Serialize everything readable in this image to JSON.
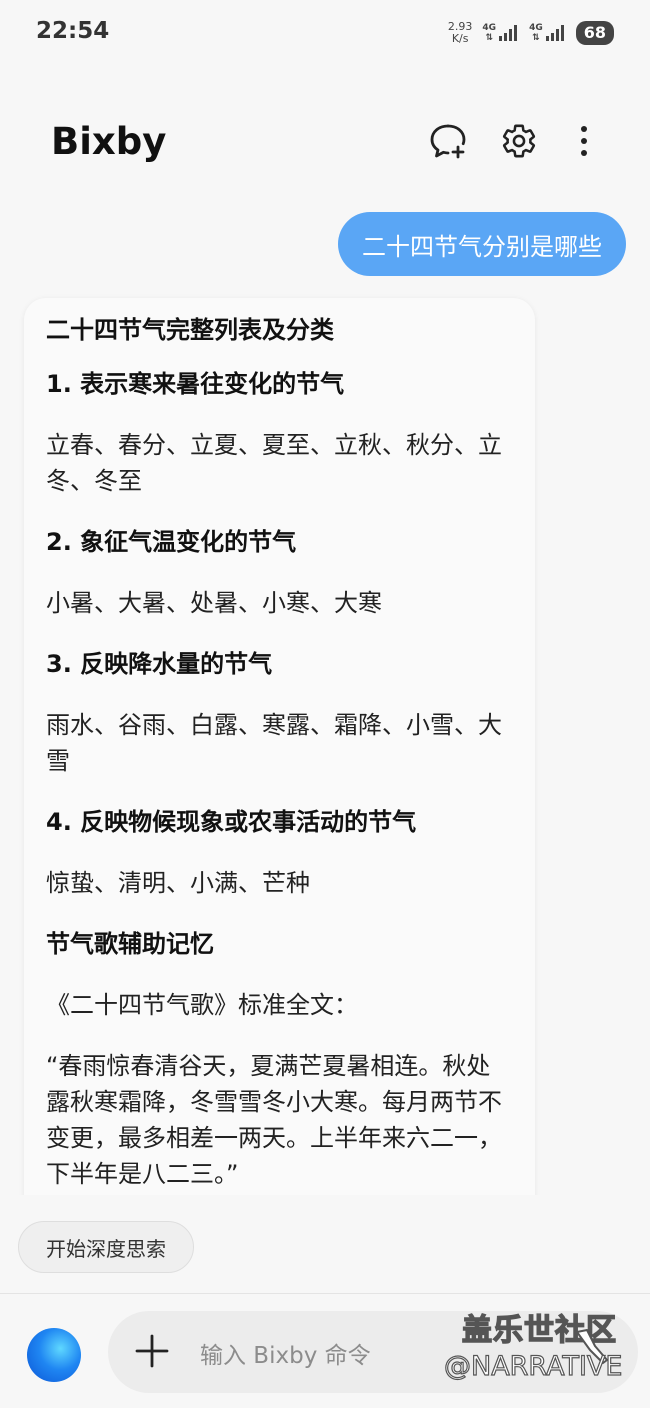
{
  "status_bar": {
    "time": "22:54",
    "net_speed_value": "2.93",
    "net_speed_unit": "K/s",
    "sim1_type": "4G",
    "sim2_type": "4G",
    "battery": "68"
  },
  "header": {
    "title": "Bixby"
  },
  "chat": {
    "user_message": "二十四节气分别是哪些",
    "reply": {
      "title": "二十四节气完整列表及分类",
      "s1_heading": "1. 表示寒来暑往变化的节气",
      "s1_body": "立春、春分、立夏、夏至、立秋、秋分、立冬、冬至",
      "s2_heading": "2. 象征气温变化的节气",
      "s2_body": "小暑、大暑、处暑、小寒、大寒",
      "s3_heading": "3. 反映降水量的节气",
      "s3_body": "雨水、谷雨、白露、寒露、霜降、小雪、大雪",
      "s4_heading": "4. 反映物候现象或农事活动的节气",
      "s4_body": "惊蛰、清明、小满、芒种",
      "song_heading": "节气歌辅助记忆",
      "song_intro": "《二十四节气歌》标准全文：",
      "song_text": "“春雨惊春清谷天，夏满芒夏暑相连。秋处露秋寒霜降，冬雪雪冬小大寒。每月两节不变更，最多相差一两天。上半年来六二一，下半年是八二三。”"
    }
  },
  "deep_think_chip": "开始深度思索",
  "input": {
    "placeholder": "输入 Bixby 命令"
  },
  "watermark": {
    "line1": "盖乐世社区",
    "line2": "@NARRATIVE"
  },
  "colors": {
    "user_bubble": "#5aa6f5",
    "background": "#f7f7f7",
    "card": "#fafafa"
  }
}
